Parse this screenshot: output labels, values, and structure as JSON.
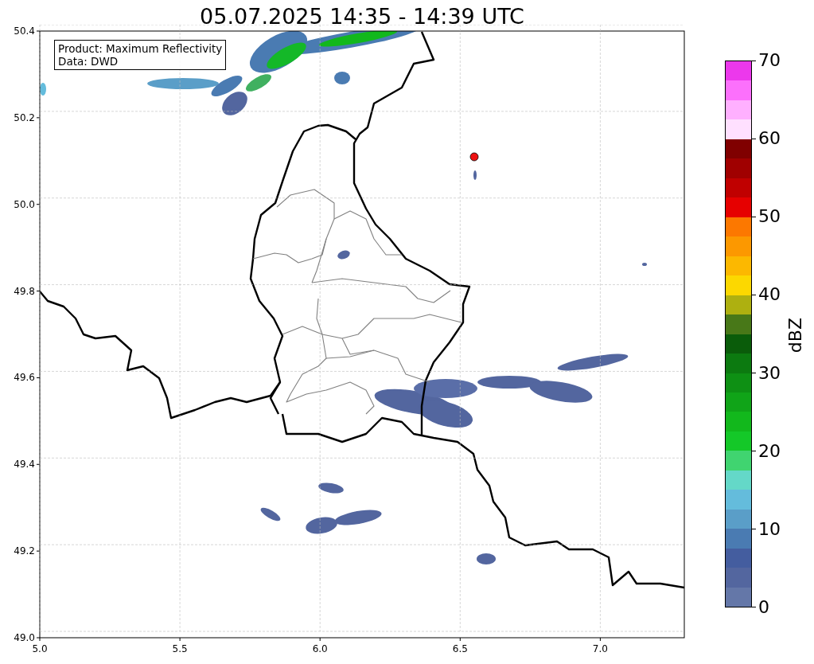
{
  "title": "05.07.2025 14:35 - 14:39 UTC",
  "info_box": {
    "lines": [
      "Product: Maximum Reflectivity",
      "Data: DWD"
    ]
  },
  "x_ticks": [
    "5.0",
    "5.5",
    "6.0",
    "6.5",
    "7.0"
  ],
  "y_ticks": [
    "50.4",
    "50.2",
    "50.0",
    "49.8",
    "49.6",
    "49.4",
    "49.2",
    "49.0"
  ],
  "colorbar": {
    "label": "dBZ",
    "ticks": [
      "70",
      "60",
      "50",
      "40",
      "30",
      "20",
      "10",
      "0"
    ],
    "bins": [
      {
        "color": "#ec38ec"
      },
      {
        "color": "#fc70fc"
      },
      {
        "color": "#ffb0ff"
      },
      {
        "color": "#ffe0ff"
      },
      {
        "color": "#800000"
      },
      {
        "color": "#a00000"
      },
      {
        "color": "#c00000"
      },
      {
        "color": "#e60000"
      },
      {
        "color": "#fc7800"
      },
      {
        "color": "#fc9800"
      },
      {
        "color": "#fcb800"
      },
      {
        "color": "#fcd800"
      },
      {
        "color": "#aeb010"
      },
      {
        "color": "#487818"
      },
      {
        "color": "#0a5c0a"
      },
      {
        "color": "#0c7a10"
      },
      {
        "color": "#0e9014"
      },
      {
        "color": "#10a418"
      },
      {
        "color": "#12b81c"
      },
      {
        "color": "#14c828"
      },
      {
        "color": "#40d470"
      },
      {
        "color": "#64d8c8"
      },
      {
        "color": "#64bcdc"
      },
      {
        "color": "#5a9ec8"
      },
      {
        "color": "#4a7bb2"
      },
      {
        "color": "#445d9f"
      },
      {
        "color": "#53669f"
      },
      {
        "color": "#6477a8"
      }
    ]
  }
}
